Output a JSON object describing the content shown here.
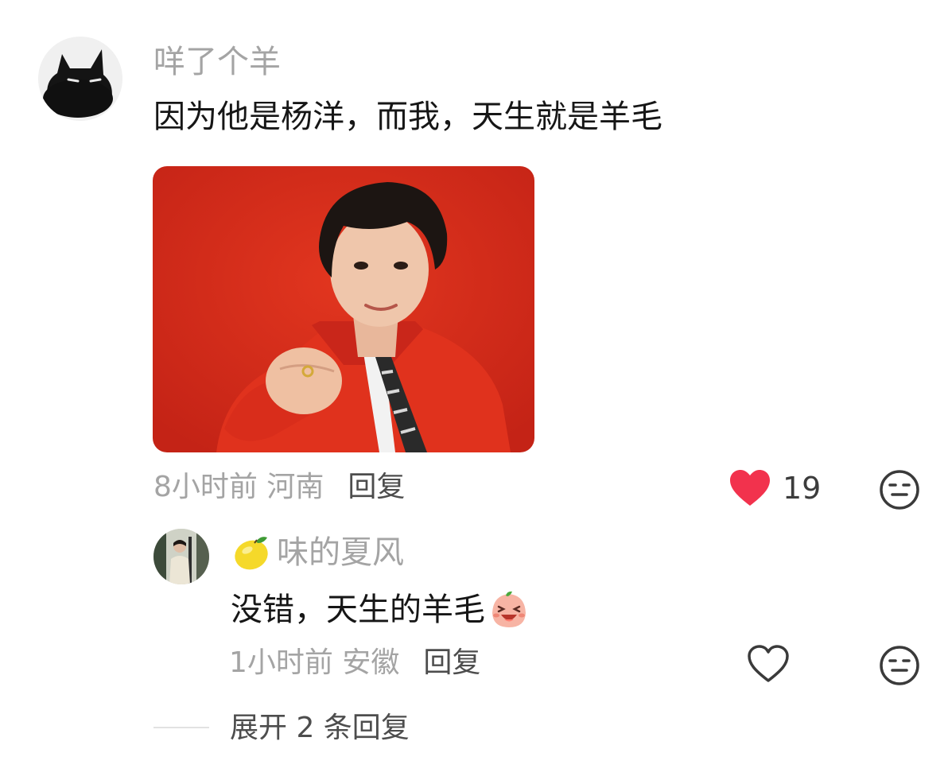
{
  "colors": {
    "username": "#a4a4a4",
    "comment_text": "#161616",
    "action_text": "#4d4d4d",
    "like_active": "#f2324d",
    "photo_background": "#d42a1c"
  },
  "comment": {
    "username": "咩了个羊",
    "text": "因为他是杨洋，而我，天生就是羊毛",
    "meta": "8小时前 河南",
    "reply_label": "回复",
    "like_count": "19",
    "like_icon": "heart-filled-icon",
    "emoji_icon": "neutral-face-icon"
  },
  "reply": {
    "badge_icon": "lemon-emoji",
    "username": "味的夏风",
    "text": "没错，天生的羊毛",
    "sticker_icon": "laughing-peach-emoji",
    "meta": "1小时前 安徽",
    "reply_label": "回复",
    "like_icon": "heart-outline-icon",
    "emoji_icon": "neutral-face-icon"
  },
  "expand": {
    "label": "展开 2 条回复"
  }
}
